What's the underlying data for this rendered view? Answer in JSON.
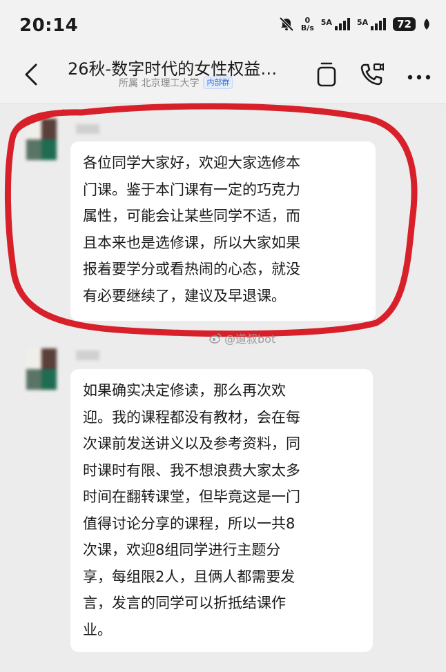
{
  "status_bar": {
    "time": "20:14",
    "net_speed_value": "0",
    "net_speed_unit": "B/s",
    "signal1_label": "5A",
    "signal2_label": "5A",
    "battery": "72"
  },
  "header": {
    "title": "26秋-数字时代的女性权益…",
    "affiliation": "所属 北京理工大学",
    "tag": "内部群"
  },
  "messages": [
    {
      "text": "各位同学大家好，欢迎大家选修本\n门课。鉴于本门课有一定的巧克力\n属性，可能会让某些同学不适，而\n且本来也是选修课，所以大家如果\n报着要学分或看热闹的心态，就没\n有必要继续了，建议及早退课。"
    },
    {
      "text": "如果确实决定修读，那么再次欢\n迎。我的课程都没有教材，会在每\n次课前发送讲义以及参考资料，同\n时课时有限、我不想浪费大家太多\n时间在翻转课堂，但毕竟这是一门\n值得讨论分享的课程，所以一共8\n次课，欢迎8组同学进行主题分\n享，每组限2人，且俩人都需要发\n言，发言的同学可以折抵结课作\n业。"
    }
  ],
  "watermark": "@道叔bot",
  "colors": {
    "highlight_circle": "#d8202a",
    "tag_blue": "#2e6bd8"
  }
}
